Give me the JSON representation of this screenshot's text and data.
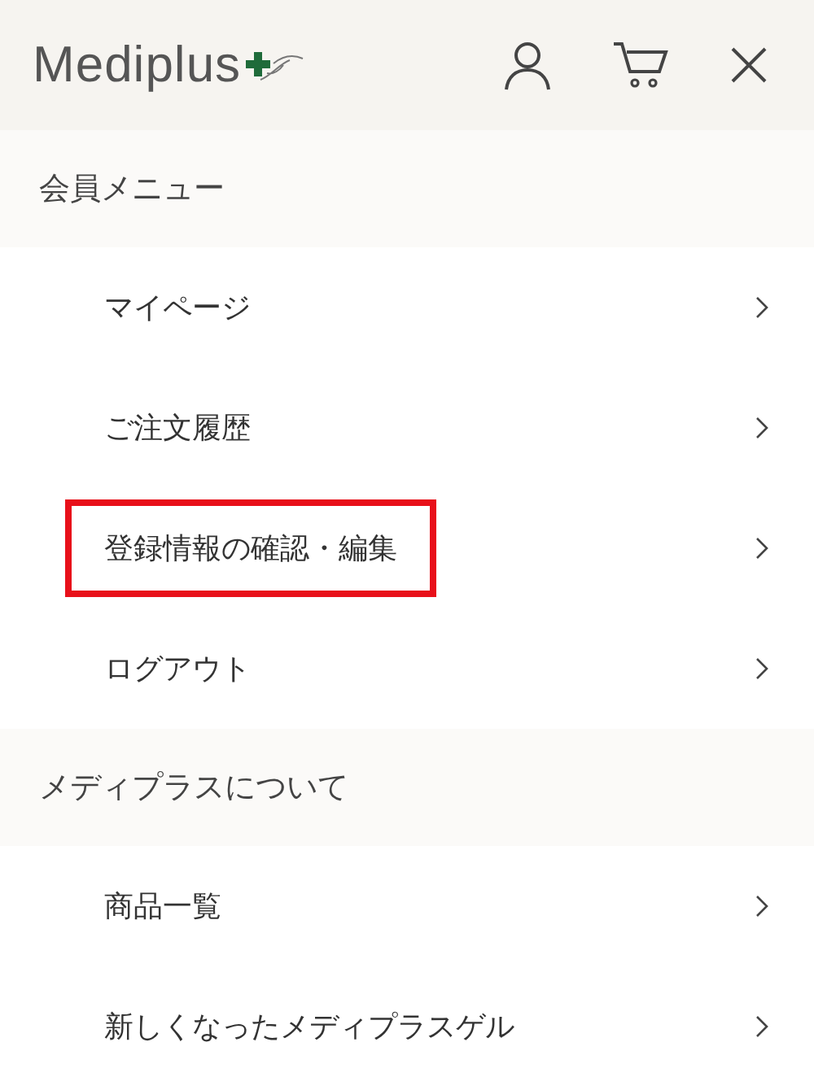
{
  "header": {
    "logo": "Mediplus"
  },
  "sections": [
    {
      "title": "会員メニュー",
      "items": [
        {
          "label": "マイページ",
          "highlighted": false
        },
        {
          "label": "ご注文履歴",
          "highlighted": false
        },
        {
          "label": "登録情報の確認・編集",
          "highlighted": true
        },
        {
          "label": "ログアウト",
          "highlighted": false
        }
      ]
    },
    {
      "title": "メディプラスについて",
      "items": [
        {
          "label": "商品一覧",
          "highlighted": false
        },
        {
          "label": "新しくなったメディプラスゲル",
          "highlighted": false
        }
      ]
    }
  ]
}
